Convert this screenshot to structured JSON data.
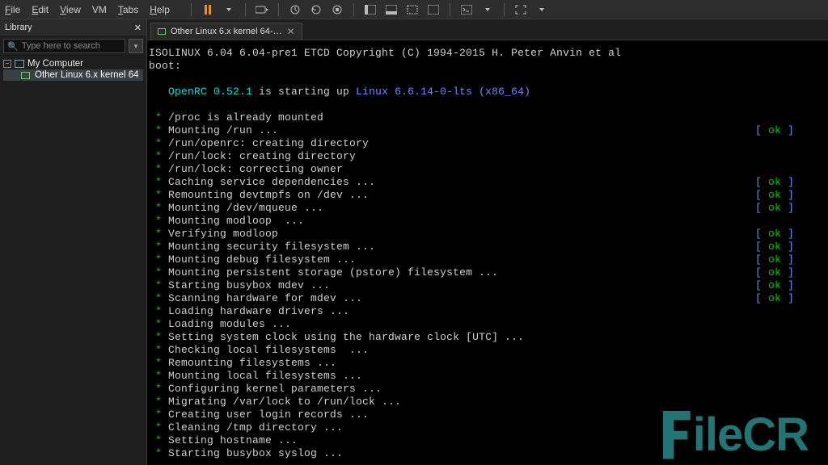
{
  "menubar": {
    "file": "File",
    "edit": "Edit",
    "view": "View",
    "vm": "VM",
    "tabs": "Tabs",
    "help": "Help"
  },
  "sidebar": {
    "title": "Library",
    "search_placeholder": "Type here to search",
    "root_label": "My Computer",
    "vm_label": "Other Linux 6.x kernel 64"
  },
  "tab": {
    "label": "Other Linux 6.x kernel 64-…"
  },
  "console": {
    "iso_line": "ISOLINUX 6.04 6.04-pre1 ETCD Copyright (C) 1994-2015 H. Peter Anvin et al",
    "boot": "boot:",
    "openrc_pre": "   OpenRC ",
    "openrc_ver": "0.52.1",
    "openrc_mid": " is starting up ",
    "openrc_kernel": "Linux 6.6.14-0-lts (x86_64)",
    "lines": [
      {
        "msg": "/proc is already mounted",
        "ok": false
      },
      {
        "msg": "Mounting /run ...",
        "ok": true
      },
      {
        "msg": "/run/openrc: creating directory",
        "ok": false
      },
      {
        "msg": "/run/lock: creating directory",
        "ok": false
      },
      {
        "msg": "/run/lock: correcting owner",
        "ok": false
      },
      {
        "msg": "Caching service dependencies ...",
        "ok": true
      },
      {
        "msg": "Remounting devtmpfs on /dev ...",
        "ok": true
      },
      {
        "msg": "Mounting /dev/mqueue ...",
        "ok": true
      },
      {
        "msg": "Mounting modloop  ...",
        "ok": false
      },
      {
        "msg": "Verifying modloop",
        "ok": true
      },
      {
        "msg": "Mounting security filesystem ...",
        "ok": true
      },
      {
        "msg": "Mounting debug filesystem ...",
        "ok": true
      },
      {
        "msg": "Mounting persistent storage (pstore) filesystem ...",
        "ok": true
      },
      {
        "msg": "Starting busybox mdev ...",
        "ok": true
      },
      {
        "msg": "Scanning hardware for mdev ...",
        "ok": true
      },
      {
        "msg": "Loading hardware drivers ...",
        "ok": false
      },
      {
        "msg": "Loading modules ...",
        "ok": false
      },
      {
        "msg": "Setting system clock using the hardware clock [UTC] ...",
        "ok": false
      },
      {
        "msg": "Checking local filesystems  ...",
        "ok": false
      },
      {
        "msg": "Remounting filesystems ...",
        "ok": false
      },
      {
        "msg": "Mounting local filesystems ...",
        "ok": false
      },
      {
        "msg": "Configuring kernel parameters ...",
        "ok": false
      },
      {
        "msg": "Migrating /var/lock to /run/lock ...",
        "ok": false
      },
      {
        "msg": "Creating user login records ...",
        "ok": false
      },
      {
        "msg": "Cleaning /tmp directory ...",
        "ok": false
      },
      {
        "msg": "Setting hostname ...",
        "ok": false
      },
      {
        "msg": "Starting busybox syslog ...",
        "ok": false
      }
    ],
    "ok_open": "[ ",
    "ok_word": "ok",
    "ok_close": " ]"
  },
  "watermark": "ileCR"
}
